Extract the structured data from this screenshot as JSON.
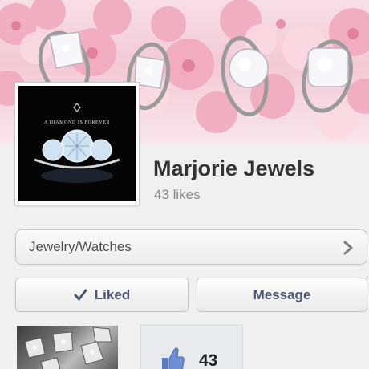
{
  "page": {
    "name": "Marjorie Jewels",
    "likes_text": "43 likes"
  },
  "profile_picture": {
    "tagline": "A DIAMOND IS FOREVER"
  },
  "category": {
    "label": "Jewelry/Watches",
    "icon": "chevron-right-icon"
  },
  "actions": {
    "liked_label": "Liked",
    "liked_icon": "checkmark-icon",
    "message_label": "Message"
  },
  "tiles": {
    "likes_count": "43",
    "likes_icon": "thumbs-up-icon"
  },
  "colors": {
    "button_text": "#4c566e",
    "title_text": "#333333",
    "subtle_text": "#8a8a8a",
    "cover_pink": "#f3c9d6"
  }
}
